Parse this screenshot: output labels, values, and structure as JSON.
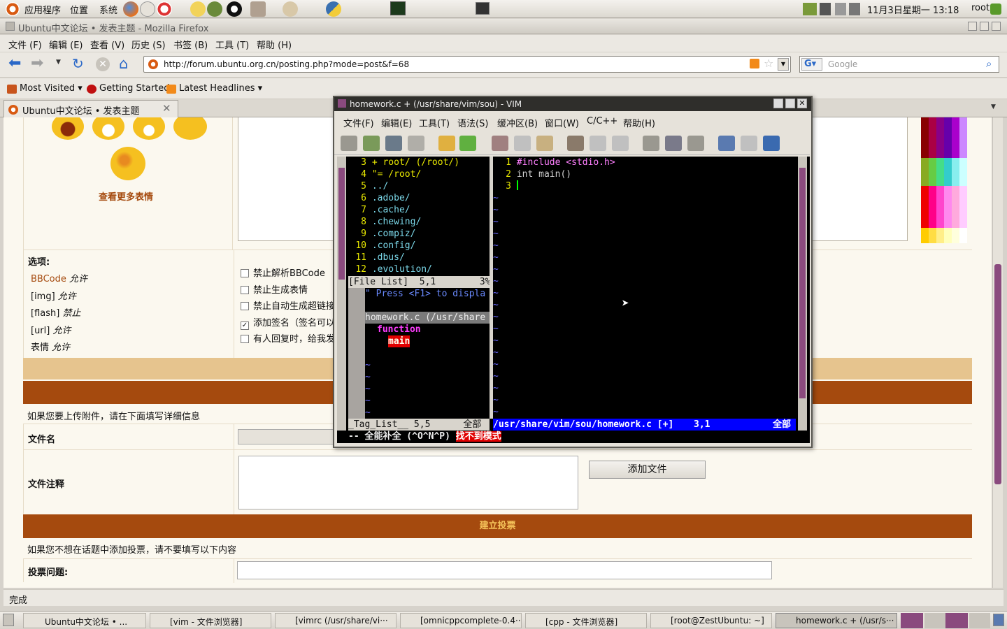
{
  "top_panel": {
    "menu_apps": "应用程序",
    "menu_places": "位置",
    "menu_system": "系统",
    "clock": "11月3日星期一 13:18",
    "user": "root"
  },
  "firefox": {
    "title": "Ubuntu中文论坛 • 发表主题 - Mozilla Firefox",
    "menu": [
      "文件 (F)",
      "编辑 (E)",
      "查看 (V)",
      "历史 (S)",
      "书签 (B)",
      "工具 (T)",
      "帮助 (H)"
    ],
    "url": "http://forum.ubuntu.org.cn/posting.php?mode=post&f=68",
    "search_placeholder": "Google",
    "bookmarks": [
      "Most Visited ▾",
      "Getting Started",
      "Latest Headlines ▾"
    ],
    "tab_label": "Ubuntu中文论坛 • 发表主题",
    "status": "完成"
  },
  "forum": {
    "more_smilies": "查看更多表情",
    "options_label": "选项:",
    "permissions": [
      {
        "name": "BBCode",
        "value": "允许"
      },
      {
        "name": "[img]",
        "value": "允许"
      },
      {
        "name": "[flash]",
        "value": "禁止"
      },
      {
        "name": "[url]",
        "value": "允许"
      },
      {
        "name": "表情",
        "value": "允许"
      }
    ],
    "checkboxes": [
      {
        "label": "禁止解析BBCode",
        "checked": false
      },
      {
        "label": "禁止生成表情",
        "checked": false
      },
      {
        "label": "禁止自动生成超链接",
        "checked": false
      },
      {
        "label": "添加签名（签名可以",
        "checked": true
      },
      {
        "label": "有人回复时，给我发",
        "checked": false
      }
    ],
    "attach_info": "如果您要上传附件，请在下面填写详细信息",
    "filename_label": "文件名",
    "file_comment_label": "文件注释",
    "add_file_button": "添加文件",
    "poll_header": "建立投票",
    "poll_info": "如果您不想在话题中添加投票，请不要填写以下内容",
    "poll_question_label": "投票问题:"
  },
  "vim": {
    "title": "homework.c + (/usr/share/vim/sou) - VIM",
    "menu": [
      "文件(F)",
      "编辑(E)",
      "工具(T)",
      "语法(S)",
      "缓冲区(B)",
      "窗口(W)",
      "C/C++",
      "帮助(H)"
    ],
    "file_list": [
      {
        "num": "3",
        "text": "+ root/ (/root/)"
      },
      {
        "num": "4",
        "text": "\"= /root/"
      },
      {
        "num": "5",
        "text": "../"
      },
      {
        "num": "6",
        "text": ".adobe/"
      },
      {
        "num": "7",
        "text": ".cache/"
      },
      {
        "num": "8",
        "text": ".chewing/"
      },
      {
        "num": "9",
        "text": ".compiz/"
      },
      {
        "num": "10",
        "text": ".config/"
      },
      {
        "num": "11",
        "text": ".dbus/"
      },
      {
        "num": "12",
        "text": ".evolution/"
      }
    ],
    "file_list_status": "[File List]  5,1        3%",
    "taglist_help": "\" Press <F1> to displa",
    "taglist_file": "homework.c (/usr/share",
    "taglist_kind": "function",
    "taglist_tag": "main",
    "taglist_status": "_Tag_List__ 5,5      全部",
    "code": [
      {
        "num": "1",
        "text": "#include <stdio.h>"
      },
      {
        "num": "2",
        "text": "int main()"
      },
      {
        "num": "3",
        "text": ""
      }
    ],
    "main_status_path": "/usr/share/vim/sou/homework.c [+]",
    "main_status_pos": "3,1",
    "main_status_all": "全部",
    "mode_line": "-- 全能补全 (^O^N^P)",
    "mode_error": "找不到模式"
  },
  "taskbar": [
    "Ubuntu中文论坛 • ...",
    "[vim - 文件浏览器]",
    "[vimrc (/usr/share/vi···",
    "[omnicppcomplete-0.4···",
    "[cpp - 文件浏览器]",
    "[root@ZestUbuntu: ~]",
    "homework.c + (/usr/s···"
  ],
  "colors": {
    "forum_brown": "#a54a0e",
    "forum_tan": "#e6c48e",
    "vim_status_blue": "#0000ff",
    "vim_error_red": "#e00000"
  }
}
